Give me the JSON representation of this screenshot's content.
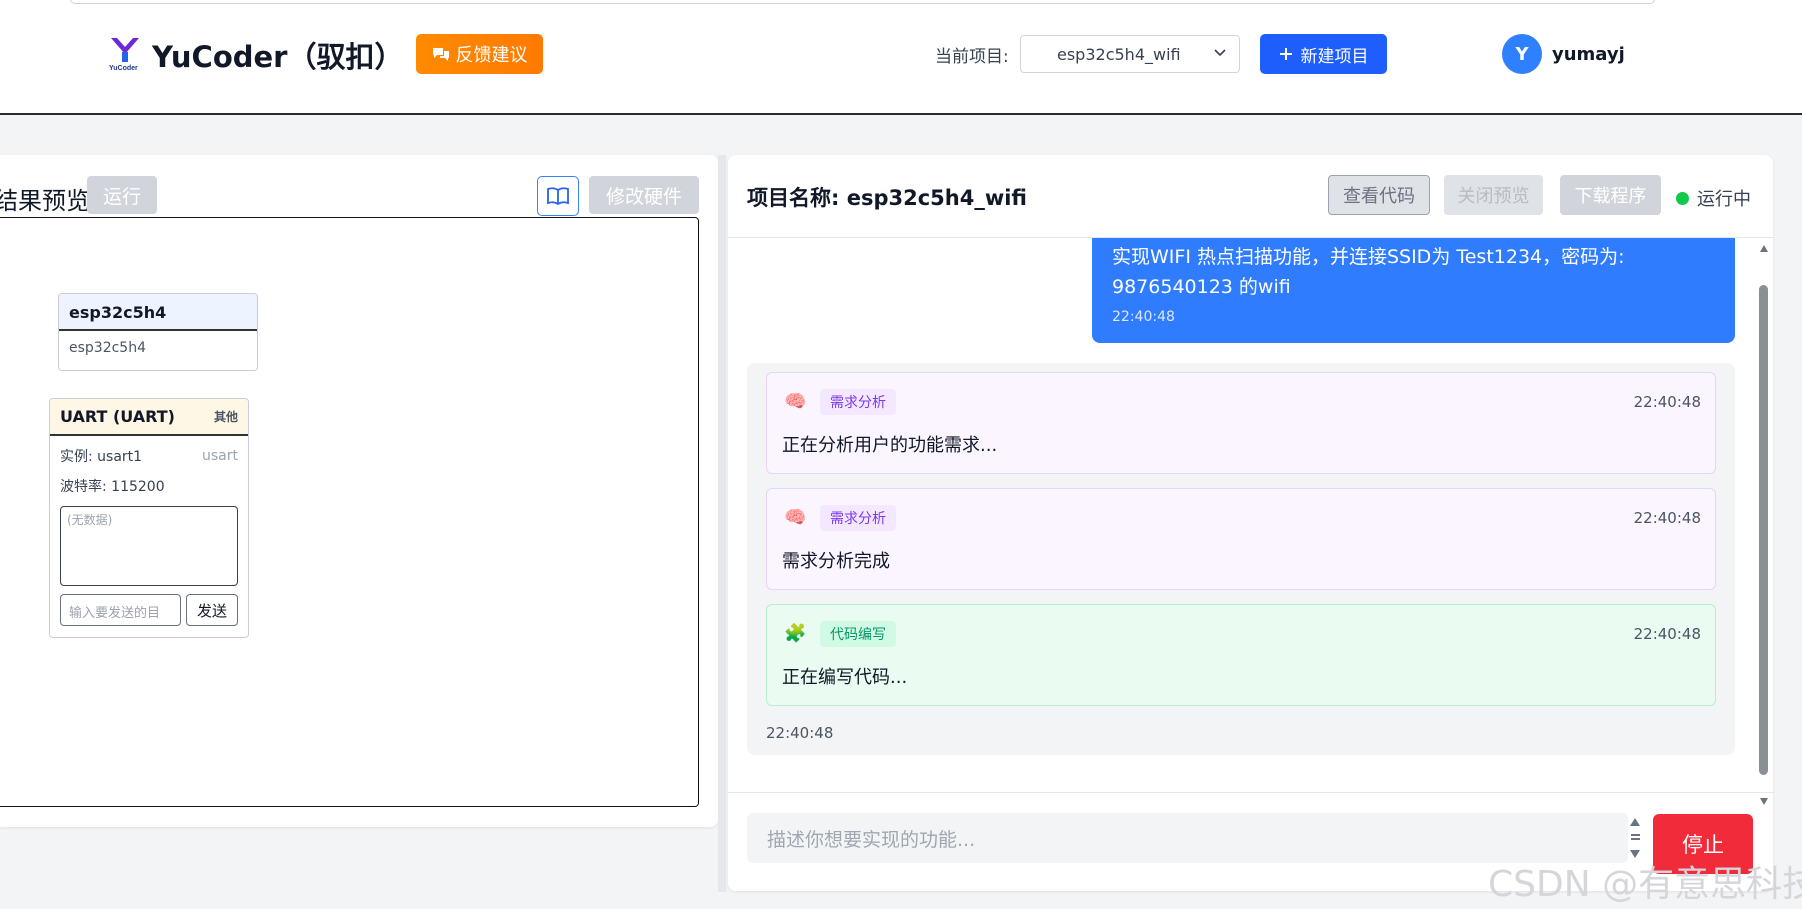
{
  "header": {
    "brand": "YuCoder（驭扣）",
    "logo_caption": "YuCoder",
    "feedback_label": "反馈建议",
    "project_label": "当前项目:",
    "project_value": "esp32c5h4_wifi",
    "new_project_label": "新建项目",
    "avatar_initial": "Y",
    "username": "yumayj"
  },
  "left": {
    "title": "结果预览",
    "run_label": "运行",
    "modify_hw_label": "修改硬件",
    "card_chip": {
      "title": "esp32c5h4",
      "body": "esp32c5h4"
    },
    "card_uart": {
      "title": "UART (UART)",
      "tag": "其他",
      "instance_label": "实例: usart1",
      "instance_type": "usart",
      "baud_label": "波特率: 115200",
      "data_placeholder": "(无数据)",
      "send_placeholder": "输入要发送的目",
      "send_label": "发送"
    }
  },
  "right": {
    "title": "项目名称: esp32c5h4_wifi",
    "view_code_label": "查看代码",
    "close_preview_label": "关闭预览",
    "download_label": "下载程序",
    "status_text": "运行中",
    "user_message": {
      "text": "实现WIFI 热点扫描功能，并连接SSID为 Test1234，密码为: 9876540123 的wifi",
      "time": "22:40:48"
    },
    "messages": [
      {
        "badge": "需求分析",
        "time": "22:40:48",
        "text": "正在分析用户的功能需求...",
        "kind": "analysis"
      },
      {
        "badge": "需求分析",
        "time": "22:40:48",
        "text": "需求分析完成",
        "kind": "analysis"
      },
      {
        "badge": "代码编写",
        "time": "22:40:48",
        "text": "正在编写代码...",
        "kind": "code"
      }
    ],
    "group_time": "22:40:48",
    "input_placeholder": "描述你想要实现的功能...",
    "stop_label": "停止"
  },
  "watermark": "CSDN @有意思科技",
  "colors": {
    "accent_blue": "#1d5efc",
    "feedback_orange": "#ff8a00",
    "stop_red": "#f12b3a",
    "status_green": "#10c84a"
  }
}
